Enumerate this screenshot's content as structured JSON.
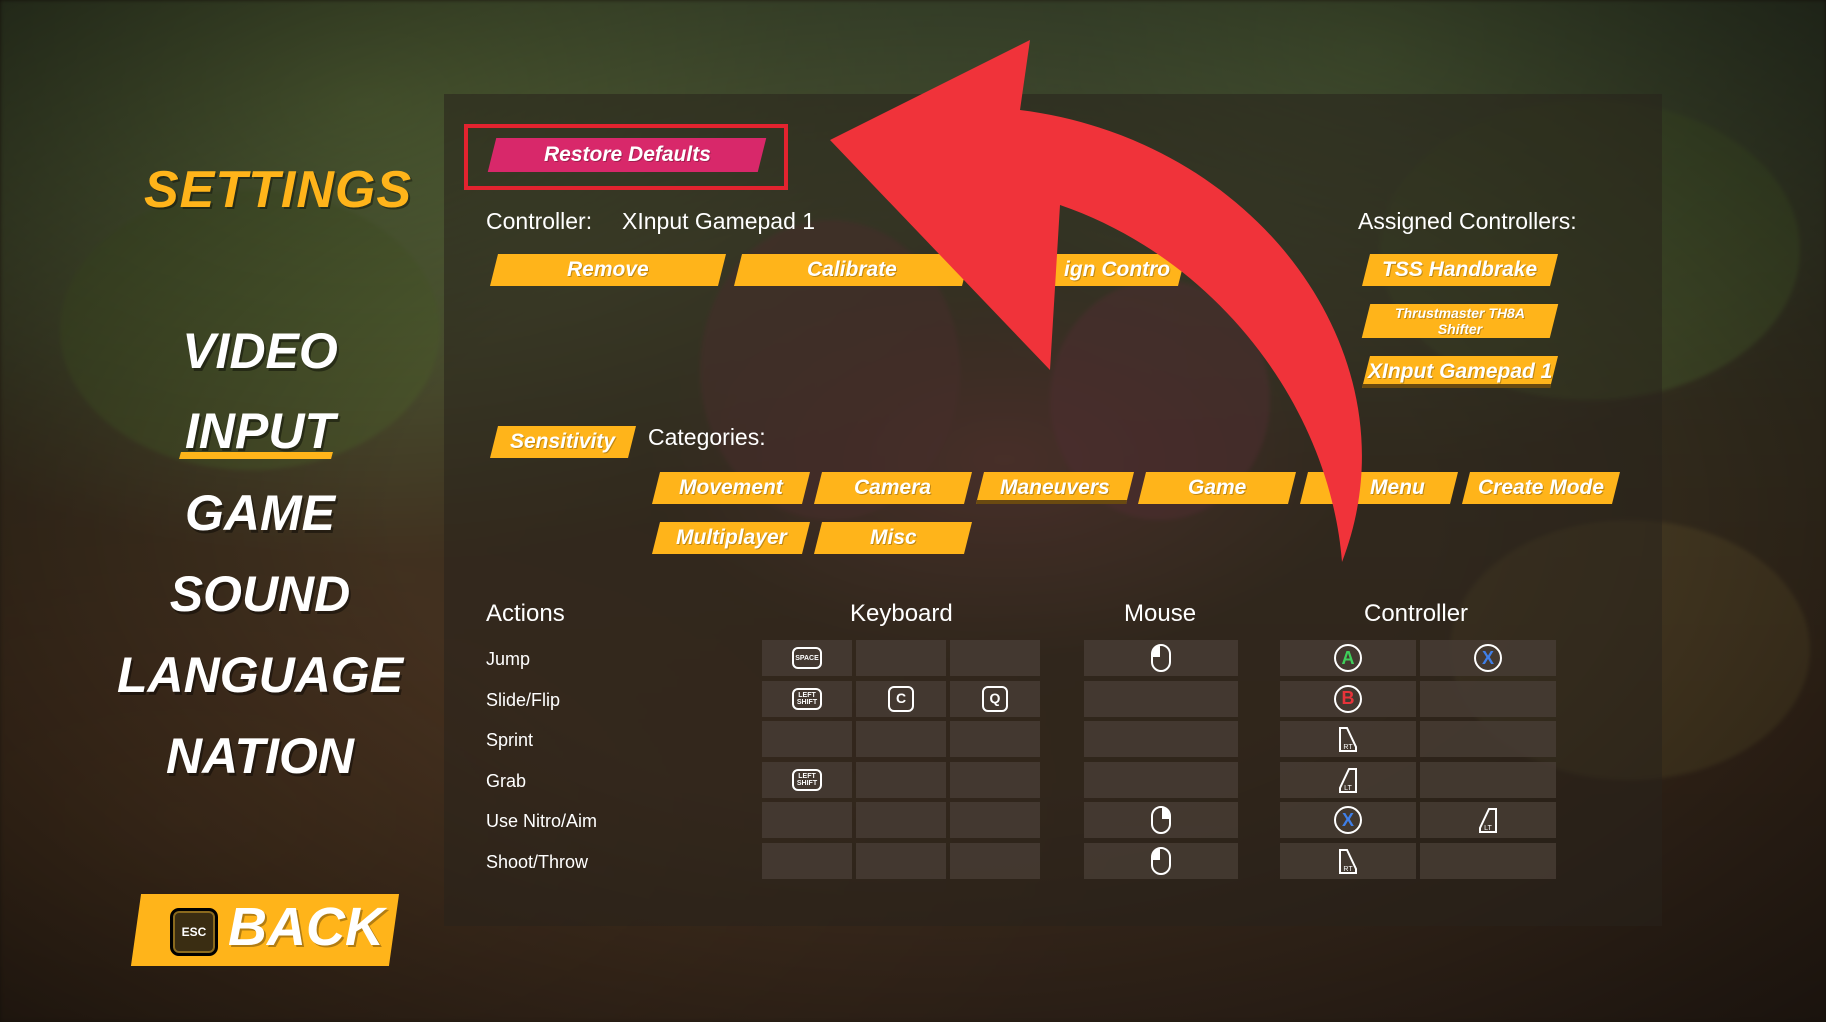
{
  "menu": {
    "title": "SETTINGS",
    "items": [
      {
        "label": "VIDEO"
      },
      {
        "label": "INPUT",
        "active": true
      },
      {
        "label": "GAME"
      },
      {
        "label": "SOUND"
      },
      {
        "label": "LANGUAGE"
      },
      {
        "label": "NATION"
      }
    ],
    "back": {
      "key": "ESC",
      "label": "BACK"
    }
  },
  "toolbar": {
    "restore_defaults": "Restore Defaults",
    "controller_label": "Controller:",
    "controller_value": "XInput Gamepad 1",
    "remove": "Remove",
    "calibrate": "Calibrate",
    "assign": "ign Contro"
  },
  "assigned": {
    "title": "Assigned Controllers:",
    "items": [
      {
        "label": "TSS Handbrake"
      },
      {
        "label": "Thrustmaster TH8A Shifter"
      },
      {
        "label": "XInput Gamepad 1"
      }
    ]
  },
  "sensitivity": "Sensitivity",
  "categories": {
    "title": "Categories:",
    "items": [
      "Movement",
      "Camera",
      "Maneuvers",
      "Game",
      "Menu",
      "Create Mode",
      "Multiplayer",
      "Misc"
    ]
  },
  "bindings": {
    "headers": {
      "actions": "Actions",
      "keyboard": "Keyboard",
      "mouse": "Mouse",
      "controller": "Controller"
    },
    "rows": [
      {
        "action": "Jump",
        "keyboard": [
          "SPACE",
          "",
          ""
        ],
        "mouse": "left-click-icon",
        "controller": [
          "A",
          "X"
        ]
      },
      {
        "action": "Slide/Flip",
        "keyboard": [
          "LEFT SHIFT",
          "C",
          "Q"
        ],
        "mouse": "",
        "controller": [
          "B",
          ""
        ]
      },
      {
        "action": "Sprint",
        "keyboard": [
          "",
          "",
          ""
        ],
        "mouse": "",
        "controller": [
          "RT",
          ""
        ]
      },
      {
        "action": "Grab",
        "keyboard": [
          "LEFT SHIFT",
          "",
          ""
        ],
        "mouse": "",
        "controller": [
          "LT",
          ""
        ]
      },
      {
        "action": "Use Nitro/Aim",
        "keyboard": [
          "",
          "",
          ""
        ],
        "mouse": "right-click-icon",
        "controller": [
          "X",
          "LT"
        ]
      },
      {
        "action": "Shoot/Throw",
        "keyboard": [
          "",
          "",
          ""
        ],
        "mouse": "left-click-icon",
        "controller": [
          "RT",
          ""
        ]
      }
    ]
  },
  "colors": {
    "accent": "#ffb41a",
    "pink": "#d8286a",
    "highlight_frame": "#e3232f",
    "arrow": "#f0333a",
    "btn_a": "#3fcf5a",
    "btn_b": "#e8333a",
    "btn_x": "#3f7fe8"
  }
}
